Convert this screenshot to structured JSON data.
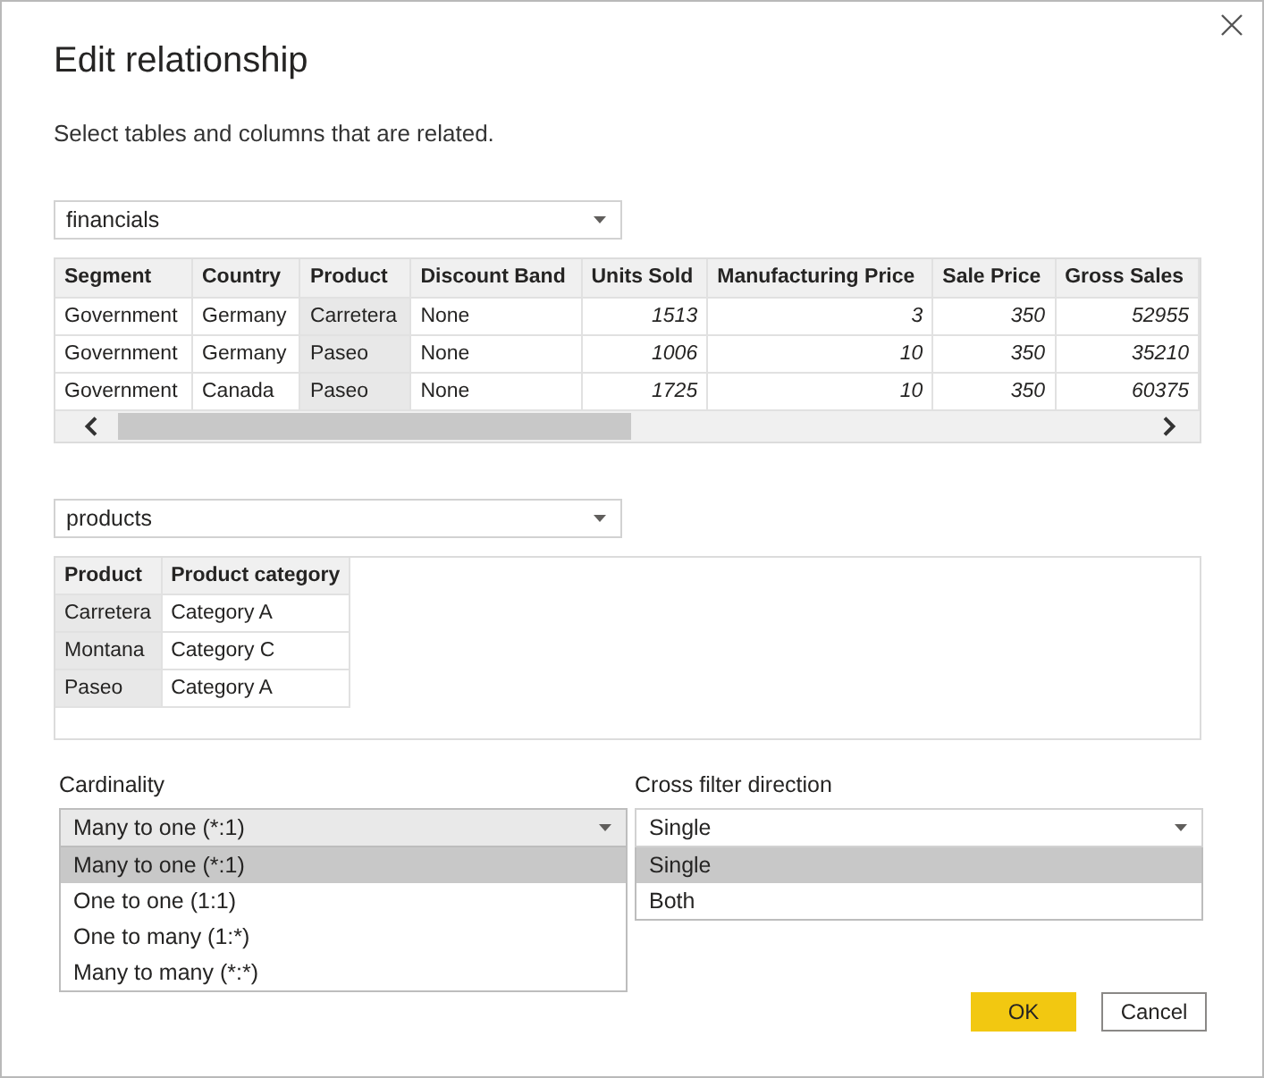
{
  "title": "Edit relationship",
  "subtitle": "Select tables and columns that are related.",
  "tables": [
    {
      "select": {
        "value": "financials"
      },
      "scrollbar": true,
      "columns": [
        {
          "label": "Segment",
          "kind": "text",
          "selected": false
        },
        {
          "label": "Country",
          "kind": "text",
          "selected": false
        },
        {
          "label": "Product",
          "kind": "text",
          "selected": true
        },
        {
          "label": "Discount Band",
          "kind": "text",
          "selected": false
        },
        {
          "label": "Units Sold",
          "kind": "number",
          "selected": false
        },
        {
          "label": "Manufacturing Price",
          "kind": "number",
          "selected": false
        },
        {
          "label": "Sale Price",
          "kind": "number",
          "selected": false
        },
        {
          "label": "Gross Sales",
          "kind": "number",
          "selected": false
        }
      ],
      "rows": [
        [
          "Government",
          "Germany",
          "Carretera",
          "None",
          "1513",
          "3",
          "350",
          "52955"
        ],
        [
          "Government",
          "Germany",
          "Paseo",
          "None",
          "1006",
          "10",
          "350",
          "35210"
        ],
        [
          "Government",
          "Canada",
          "Paseo",
          "None",
          "1725",
          "10",
          "350",
          "60375"
        ]
      ]
    },
    {
      "select": {
        "value": "products"
      },
      "scrollbar": false,
      "columns": [
        {
          "label": "Product",
          "kind": "text",
          "selected": true
        },
        {
          "label": "Product category",
          "kind": "text",
          "selected": false
        }
      ],
      "rows": [
        [
          "Carretera",
          "Category A"
        ],
        [
          "Montana",
          "Category C"
        ],
        [
          "Paseo",
          "Category A"
        ]
      ]
    }
  ],
  "dropdowns": [
    {
      "label": "Cardinality",
      "value": "Many to one (*:1)",
      "focused": true,
      "expanded": true,
      "options": [
        {
          "label": "Many to one (*:1)",
          "selected": true
        },
        {
          "label": "One to one (1:1)",
          "selected": false
        },
        {
          "label": "One to many (1:*)",
          "selected": false
        },
        {
          "label": "Many to many (*:*)",
          "selected": false
        }
      ]
    },
    {
      "label": "Cross filter direction",
      "value": "Single",
      "focused": false,
      "expanded": true,
      "options": [
        {
          "label": "Single",
          "selected": true
        },
        {
          "label": "Both",
          "selected": false
        }
      ]
    }
  ],
  "buttons": [
    {
      "label": "OK",
      "kind": "primary"
    },
    {
      "label": "Cancel",
      "kind": "secondary"
    }
  ]
}
